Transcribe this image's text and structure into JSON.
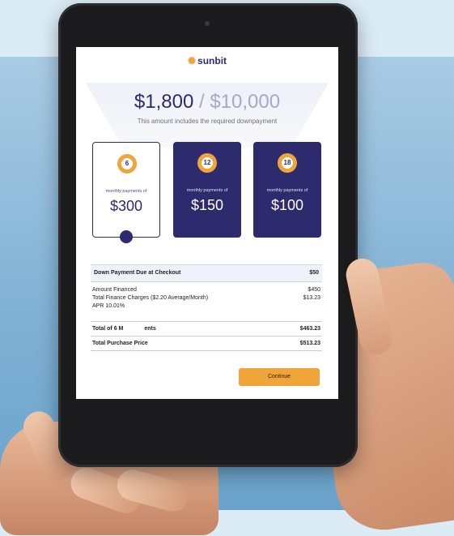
{
  "brand": {
    "name": "sunbit"
  },
  "amount": {
    "financed_display": "$1,800",
    "separator": " / ",
    "total_display": "$10,000"
  },
  "subhead": "This amount includes the required downpayment",
  "plans": [
    {
      "months": "6",
      "label": "monthly payments of",
      "amount": "$300",
      "selected": true
    },
    {
      "months": "12",
      "label": "monthly payments of",
      "amount": "$150",
      "selected": false
    },
    {
      "months": "18",
      "label": "monthly payments of",
      "amount": "$100",
      "selected": false
    }
  ],
  "summary": {
    "down_payment": {
      "label": "Down Payment Due at Checkout",
      "value": "$50"
    },
    "amount_financed": {
      "label": "Amount Financed",
      "value": "$450"
    },
    "finance_charges": {
      "label": "Total Finance Charges ($2.20 Average/Month)",
      "value": "$13.23"
    },
    "apr": {
      "label": "APR 10.01%"
    },
    "total_payments": {
      "label": "Total of 6 M",
      "label_tail": "ents",
      "value": "$463.23"
    },
    "total_purchase": {
      "label": "Total Purchase Price",
      "value": "$513.23"
    }
  },
  "continue_label": "Continue",
  "colors": {
    "brand_navy": "#2d2a6e",
    "accent_orange": "#f0a53a"
  }
}
